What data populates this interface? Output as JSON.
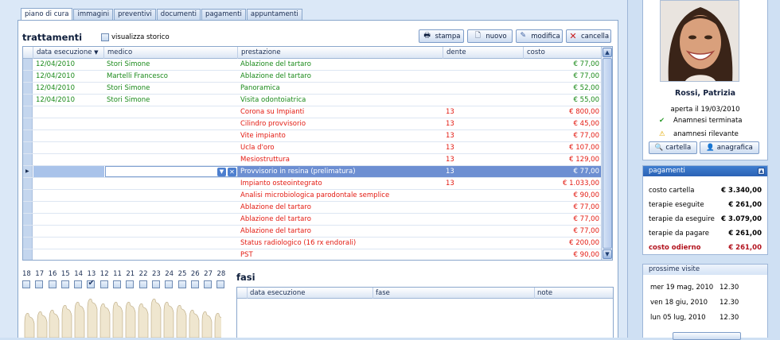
{
  "tabs": [
    "piano di cura",
    "immagini",
    "preventivi",
    "documenti",
    "pagamenti",
    "appuntamenti"
  ],
  "trattamenti": {
    "title": "trattamenti",
    "storico_label": "visualizza storico",
    "buttons": {
      "stampa": "stampa",
      "nuovo": "nuovo",
      "modifica": "modifica",
      "cancella": "cancella"
    }
  },
  "grid": {
    "columns": [
      "data esecuzione",
      "medico",
      "prestazione",
      "dente",
      "costo"
    ],
    "rows": [
      {
        "date": "12/04/2010",
        "medico": "Stori Simone",
        "prestazione": "Ablazione del tartaro",
        "dente": "",
        "costo": "€ 77,00",
        "color": "green"
      },
      {
        "date": "12/04/2010",
        "medico": "Martelli Francesco",
        "prestazione": "Ablazione del tartaro",
        "dente": "",
        "costo": "€ 77,00",
        "color": "green"
      },
      {
        "date": "12/04/2010",
        "medico": "Stori Simone",
        "prestazione": "Panoramica",
        "dente": "",
        "costo": "€ 52,00",
        "color": "green"
      },
      {
        "date": "12/04/2010",
        "medico": "Stori Simone",
        "prestazione": "Visita odontoiatrica",
        "dente": "",
        "costo": "€ 55,00",
        "color": "green"
      },
      {
        "date": "",
        "medico": "",
        "prestazione": "Corona su Impianti",
        "dente": "13",
        "costo": "€ 800,00",
        "color": "red"
      },
      {
        "date": "",
        "medico": "",
        "prestazione": "Cilindro provvisorio",
        "dente": "13",
        "costo": "€ 45,00",
        "color": "red"
      },
      {
        "date": "",
        "medico": "",
        "prestazione": "Vite impianto",
        "dente": "13",
        "costo": "€ 77,00",
        "color": "red"
      },
      {
        "date": "",
        "medico": "",
        "prestazione": "Ucla d'oro",
        "dente": "13",
        "costo": "€ 107,00",
        "color": "red"
      },
      {
        "date": "",
        "medico": "",
        "prestazione": "Mesiostruttura",
        "dente": "13",
        "costo": "€ 129,00",
        "color": "red"
      },
      {
        "date": "",
        "medico": "",
        "prestazione": "Provvisorio in resina (prelimatura)",
        "dente": "13",
        "costo": "€ 77,00",
        "color": "selected"
      },
      {
        "date": "",
        "medico": "",
        "prestazione": "Impianto osteointegrato",
        "dente": "13",
        "costo": "€ 1.033,00",
        "color": "red"
      },
      {
        "date": "",
        "medico": "",
        "prestazione": "Analisi microbiologica parodontale semplice",
        "dente": "",
        "costo": "€ 90,00",
        "color": "red"
      },
      {
        "date": "",
        "medico": "",
        "prestazione": "Ablazione del tartaro",
        "dente": "",
        "costo": "€ 77,00",
        "color": "red"
      },
      {
        "date": "",
        "medico": "",
        "prestazione": "Ablazione del tartaro",
        "dente": "",
        "costo": "€ 77,00",
        "color": "red"
      },
      {
        "date": "",
        "medico": "",
        "prestazione": "Ablazione del tartaro",
        "dente": "",
        "costo": "€ 77,00",
        "color": "red"
      },
      {
        "date": "",
        "medico": "",
        "prestazione": "Status radiologico (16 rx endorali)",
        "dente": "",
        "costo": "€ 200,00",
        "color": "red"
      },
      {
        "date": "",
        "medico": "",
        "prestazione": "PST",
        "dente": "",
        "costo": "€ 90,00",
        "color": "red"
      }
    ]
  },
  "teeth": {
    "numbers": [
      "18",
      "17",
      "16",
      "15",
      "14",
      "13",
      "12",
      "11",
      "21",
      "22",
      "23",
      "24",
      "25",
      "26",
      "27",
      "28"
    ],
    "checked_index": 5
  },
  "fasi": {
    "title": "fasi",
    "columns": [
      "data esecuzione",
      "fase",
      "note"
    ]
  },
  "patient": {
    "name": "Rossi, Patrizia",
    "opened": "aperta il 19/03/2010",
    "anamnesi1": "Anamnesi terminata",
    "anamnesi2": "anamnesi rilevante",
    "btn_cartella": "cartella",
    "btn_anagrafica": "anagrafica"
  },
  "pagamenti": {
    "title": "pagamenti",
    "items": [
      {
        "label": "costo cartella",
        "value": "€ 3.340,00"
      },
      {
        "label": "terapie eseguite",
        "value": "€ 261,00"
      },
      {
        "label": "terapie da eseguire",
        "value": "€ 3.079,00"
      },
      {
        "label": "terapie da pagare",
        "value": "€ 261,00"
      },
      {
        "label": "costo odierno",
        "value": "€ 261,00"
      }
    ]
  },
  "visite": {
    "title": "prossime visite",
    "items": [
      {
        "date": "mer 19 mag, 2010",
        "time": "12.30"
      },
      {
        "date": "ven 18 giu, 2010",
        "time": "12.30"
      },
      {
        "date": "lun 05 lug, 2010",
        "time": "12.30"
      }
    ]
  },
  "colors": {
    "green": "#1a8a1a",
    "red": "#e31b12",
    "selection": "#6d8fd2",
    "header_blue": "#2b62b5"
  }
}
